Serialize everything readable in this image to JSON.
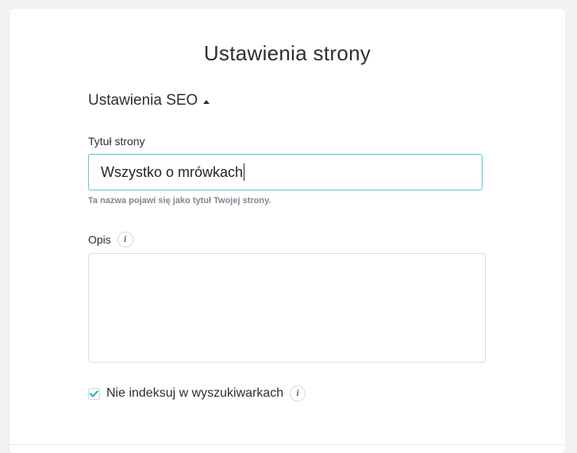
{
  "page": {
    "title": "Ustawienia strony"
  },
  "seo": {
    "toggle_label": "Ustawienia SEO",
    "title_label": "Tytuł strony",
    "title_value": "Wszystko o mrówkach",
    "title_hint": "Ta nazwa pojawi się jako tytuł Twojej strony.",
    "description_label": "Opis",
    "description_value": "",
    "noindex_label": "Nie indeksuj w wyszukiwarkach",
    "noindex_checked": true
  },
  "colors": {
    "accent": "#5bc5d1",
    "check": "#2ba6cb"
  }
}
